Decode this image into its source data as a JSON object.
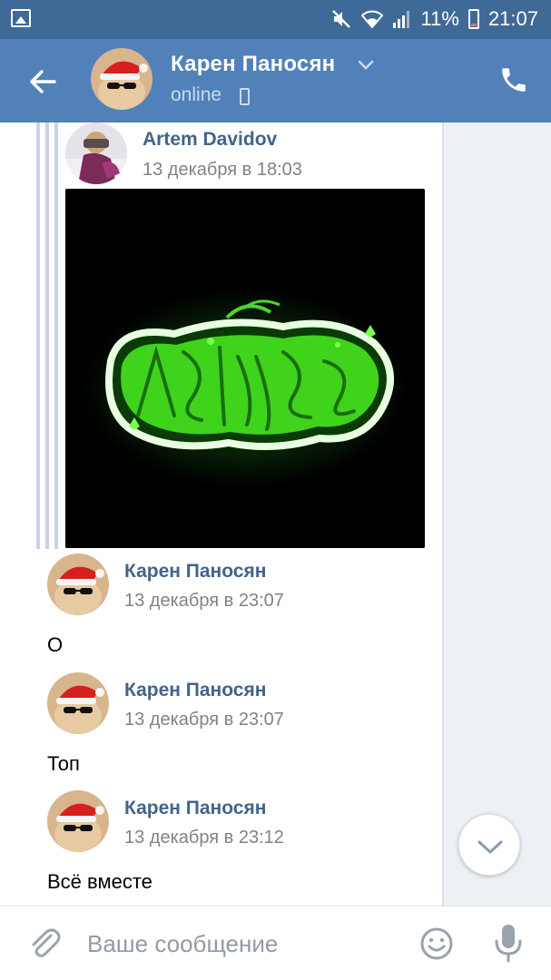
{
  "status_bar": {
    "battery": "11%",
    "time": "21:07",
    "icons": [
      "image-icon",
      "mute-icon",
      "wifi-icon",
      "signal-icon",
      "battery-icon"
    ]
  },
  "header": {
    "name": "Карен Паносян",
    "status": "online",
    "colors": {
      "bar": "#5181b8",
      "status_bar": "#3f6a97"
    }
  },
  "forwarded": {
    "author": "Artem Davidov",
    "time": "13 декабря в 18:03"
  },
  "messages": [
    {
      "author": "Карен Паносян",
      "time": "13 декабря в 23:07",
      "text": "О"
    },
    {
      "author": "Карен Паносян",
      "time": "13 декабря в 23:07",
      "text": "Топ"
    },
    {
      "author": "Карен Паносян",
      "time": "13 декабря в 23:12",
      "text": "Всё вместе"
    }
  ],
  "input": {
    "placeholder": "Ваше сообщение"
  },
  "colors": {
    "author_name": "#42648b",
    "timestamp": "#828282",
    "graffiti_green": "#4cd62a"
  }
}
